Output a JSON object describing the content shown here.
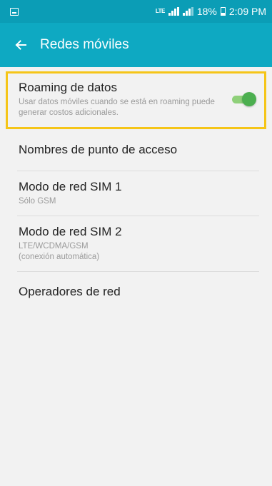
{
  "status_bar": {
    "network_label": "LTE",
    "battery_percent": "18%",
    "time": "2:09 PM"
  },
  "app_bar": {
    "title": "Redes móviles"
  },
  "settings": {
    "roaming": {
      "title": "Roaming de datos",
      "summary": "Usar datos móviles cuando se está en roaming puede generar costos adicionales.",
      "enabled": true
    },
    "apn": {
      "title": "Nombres de punto de acceso"
    },
    "sim1": {
      "title": "Modo de red SIM 1",
      "summary": "Sólo GSM"
    },
    "sim2": {
      "title": "Modo de red SIM 2",
      "summary_line1": "LTE/WCDMA/GSM",
      "summary_line2": "(conexión automática)"
    },
    "operators": {
      "title": "Operadores de red"
    }
  },
  "colors": {
    "status_bar": "#0b9db6",
    "app_bar": "#0ea9c2",
    "highlight_border": "#f5c518",
    "toggle_on": "#4caf50",
    "background": "#f2f2f2"
  },
  "icons": {
    "status_left": "screenshot-icon",
    "back": "arrow-left-icon"
  }
}
